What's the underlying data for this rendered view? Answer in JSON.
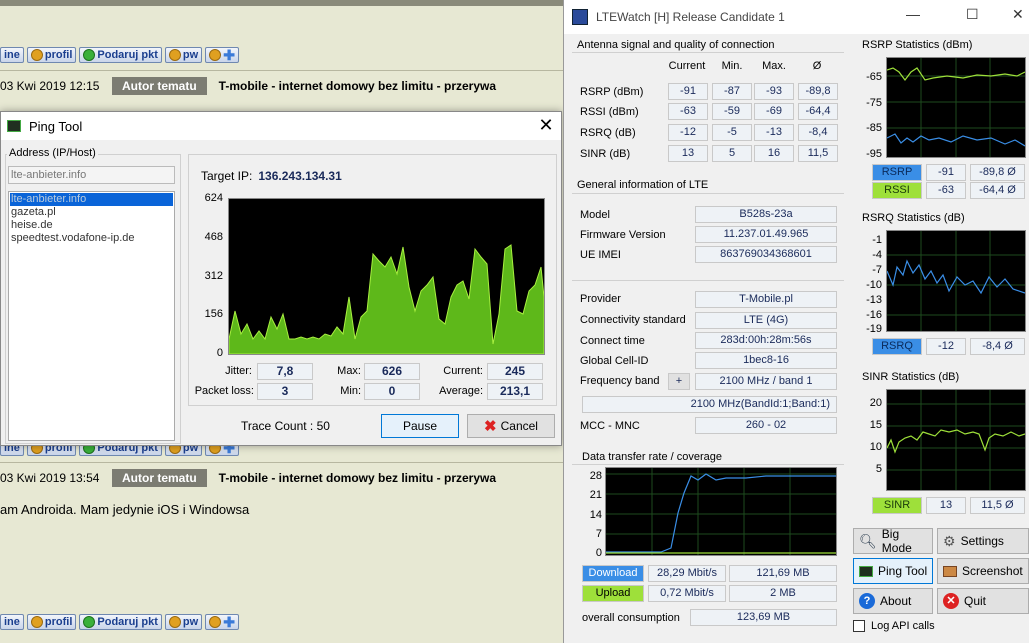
{
  "forum": {
    "btn_online": "ine",
    "btn_profil": "profil",
    "btn_podaruj": "Podaruj pkt",
    "btn_pw": "pw",
    "post1": {
      "date": "03 Kwi 2019 12:15",
      "badge": "Autor tematu",
      "title": "T-mobile - internet domowy bez limitu - przerywa"
    },
    "post2": {
      "date": "03 Kwi 2019 13:54",
      "badge": "Autor tematu",
      "title": "T-mobile - internet domowy bez limitu - przerywa"
    },
    "body_text": "am Androida. Mam jedynie iOS i Windowsa"
  },
  "ping": {
    "title": "Ping Tool",
    "address_group": "Address (IP/Host)",
    "address_input": "lte-anbieter.info",
    "address_list": [
      "lte-anbieter.info",
      "gazeta.pl",
      "heise.de",
      "speedtest.vodafone-ip.de"
    ],
    "target_label": "Target IP:",
    "target_ip": "136.243.134.31",
    "y_ticks": [
      "624",
      "468",
      "312",
      "156",
      "0"
    ],
    "jitter_label": "Jitter:",
    "jitter": "7,8",
    "max_label": "Max:",
    "max": "626",
    "current_label": "Current:",
    "current": "245",
    "packet_loss_label": "Packet loss:",
    "packet_loss": "3",
    "min_label": "Min:",
    "min": "0",
    "average_label": "Average:",
    "average": "213,1",
    "trace_count": "Trace Count : 50",
    "pause": "Pause",
    "cancel": "Cancel"
  },
  "lte": {
    "title": "LTEWatch [H]   Release Candidate 1",
    "antenna_title": "Antenna signal and quality of connection",
    "col_headers": [
      "Current",
      "Min.",
      "Max.",
      "Ø"
    ],
    "rows": [
      {
        "label": "RSRP (dBm)",
        "values": [
          "-91",
          "-87",
          "-93",
          "-89,8"
        ]
      },
      {
        "label": "RSSI (dBm)",
        "values": [
          "-63",
          "-59",
          "-69",
          "-64,4"
        ]
      },
      {
        "label": "RSRQ (dB)",
        "values": [
          "-12",
          "-5",
          "-13",
          "-8,4"
        ]
      },
      {
        "label": "SINR (dB)",
        "values": [
          "13",
          "5",
          "16",
          "11,5"
        ]
      }
    ],
    "general_title": "General information of LTE",
    "model_label": "Model",
    "model": "B528s-23a",
    "firmware_label": "Firmware Version",
    "firmware": "11.237.01.49.965",
    "imei_label": "UE IMEI",
    "imei": "863769034368601",
    "provider_label": "Provider",
    "provider": "T-Mobile.pl",
    "conn_std_label": "Connectivity standard",
    "conn_std": "LTE (4G)",
    "conn_time_label": "Connect time",
    "conn_time": "283d:00h:28m:56s",
    "cellid_label": "Global Cell-ID",
    "cellid": "1bec8-16",
    "freq_label": "Frequency band",
    "freq_plus": "+",
    "freq": "2100 MHz / band 1",
    "band_detail": "2100 MHz(BandId:1;Band:1)",
    "mcc_label": "MCC - MNC",
    "mcc": "260 - 02",
    "transfer_title": "Data transfer rate / coverage",
    "transfer_ticks": [
      "28",
      "21",
      "14",
      "7",
      "0"
    ],
    "download_label": "Download",
    "download_rate": "28,29 Mbit/s",
    "download_total": "121,69 MB",
    "upload_label": "Upload",
    "upload_rate": "0,72 Mbit/s",
    "upload_total": "2 MB",
    "overall_label": "overall consumption",
    "overall": "123,69 MB",
    "rsrp_stats_title": "RSRP Statistics (dBm)",
    "rsrp_ticks": [
      "-65",
      "-75",
      "-85",
      "-95"
    ],
    "rsrp_tag": "RSRP",
    "rsrp_cur": "-91",
    "rsrp_avg": "-89,8 Ø",
    "rssi_tag": "RSSI",
    "rssi_cur": "-63",
    "rssi_avg": "-64,4 Ø",
    "rsrq_stats_title": "RSRQ Statistics (dB)",
    "rsrq_ticks": [
      "-1",
      "-4",
      "-7",
      "-10",
      "-13",
      "-16",
      "-19"
    ],
    "rsrq_tag": "RSRQ",
    "rsrq_cur": "-12",
    "rsrq_avg": "-8,4 Ø",
    "sinr_stats_title": "SINR Statistics (dB)",
    "sinr_ticks": [
      "20",
      "15",
      "10",
      "5"
    ],
    "sinr_tag": "SINR",
    "sinr_cur": "13",
    "sinr_avg": "11,5 Ø",
    "big_mode": "Big Mode",
    "settings": "Settings",
    "ping_tool": "Ping Tool",
    "screenshot": "Screenshot",
    "about": "About",
    "quit": "Quit",
    "log_api": "Log API calls",
    "colors": {
      "blue_tag": "#3a8ee6",
      "green_tag": "#9ee03a",
      "chart_green": "#5ec21a"
    }
  }
}
